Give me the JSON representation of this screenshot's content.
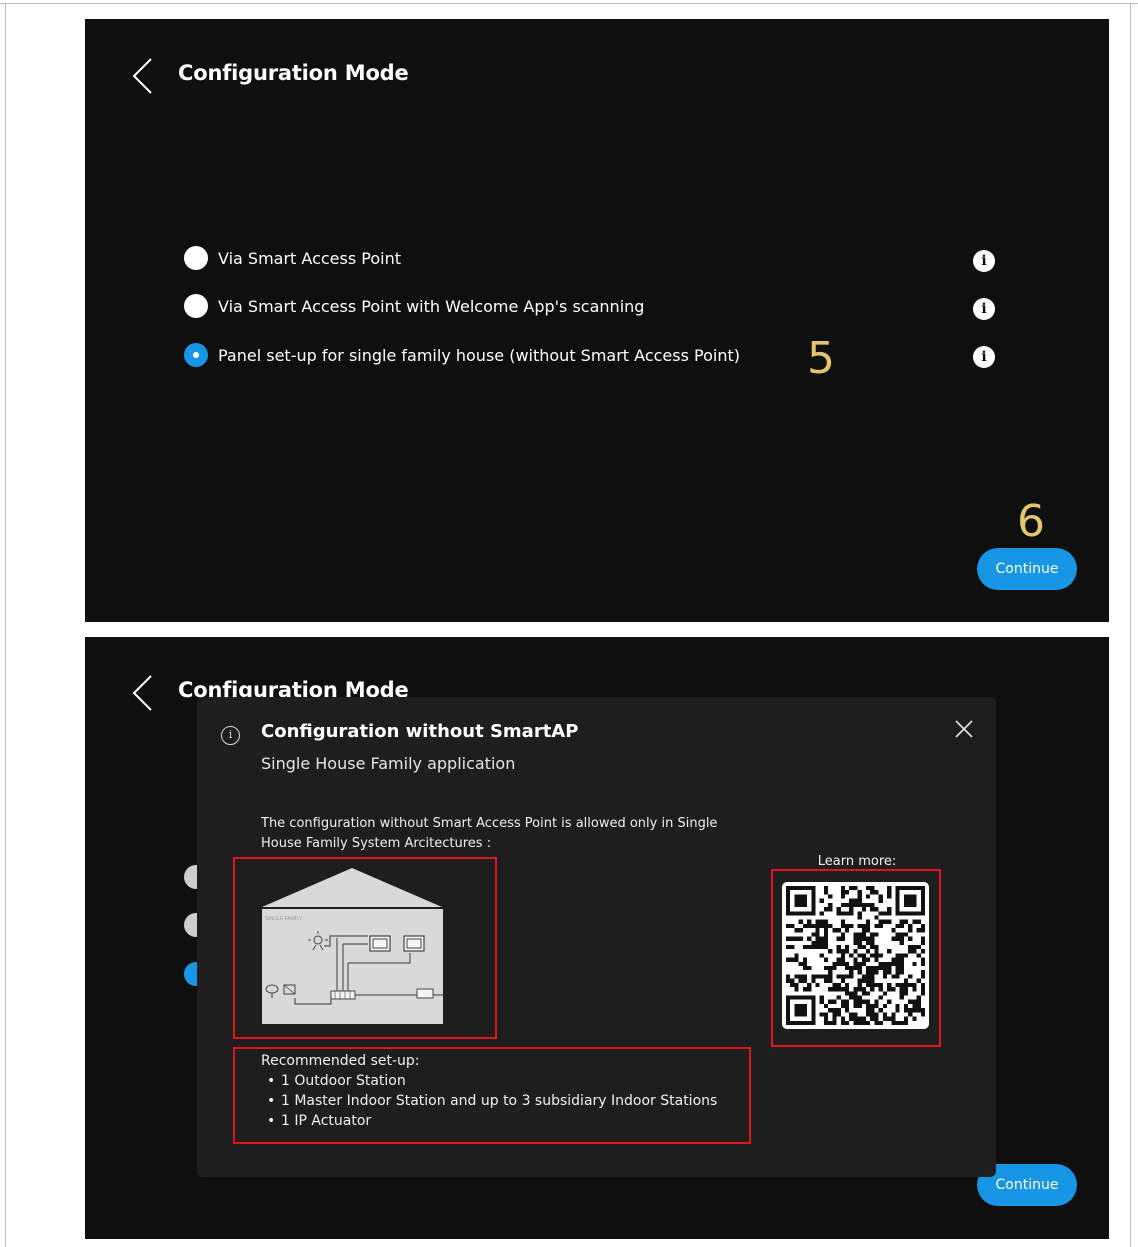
{
  "screen1": {
    "title": "Configuration Mode",
    "options": [
      {
        "label": "Via Smart Access Point",
        "selected": false
      },
      {
        "label": "Via Smart Access Point with Welcome App's scanning",
        "selected": false
      },
      {
        "label": "Panel set-up for single family house (without Smart Access Point)",
        "selected": true
      }
    ],
    "step_marker_options": "5",
    "step_marker_continue": "6",
    "continue_label": "Continue"
  },
  "screen2": {
    "title": "Configuration Mode",
    "continue_label": "Continue",
    "modal": {
      "info_glyph": "i",
      "title": "Configuration without SmartAP",
      "subtitle": "Single House Family application",
      "description": "The configuration without Smart Access Point is allowed only in Single House Family System Arcitectures :",
      "diagram_caption": "SINGLE FAMILY",
      "learn_more_label": "Learn more:",
      "setup_heading": "Recommended set-up:",
      "setup_items": [
        "1 Outdoor Station",
        "1 Master Indoor Station and up to 3 subsidiary Indoor Stations",
        "1 IP Actuator"
      ]
    }
  },
  "colors": {
    "screen_bg": "#0f0f0f",
    "modal_bg": "#1e1e1e",
    "accent_blue": "#1796e5",
    "step_marker": "#e3c56a",
    "highlight_red": "#e0161e"
  },
  "icons": {
    "back": "chevron-left-icon",
    "info": "info-icon",
    "close": "close-icon",
    "qr": "qr-code-icon"
  }
}
